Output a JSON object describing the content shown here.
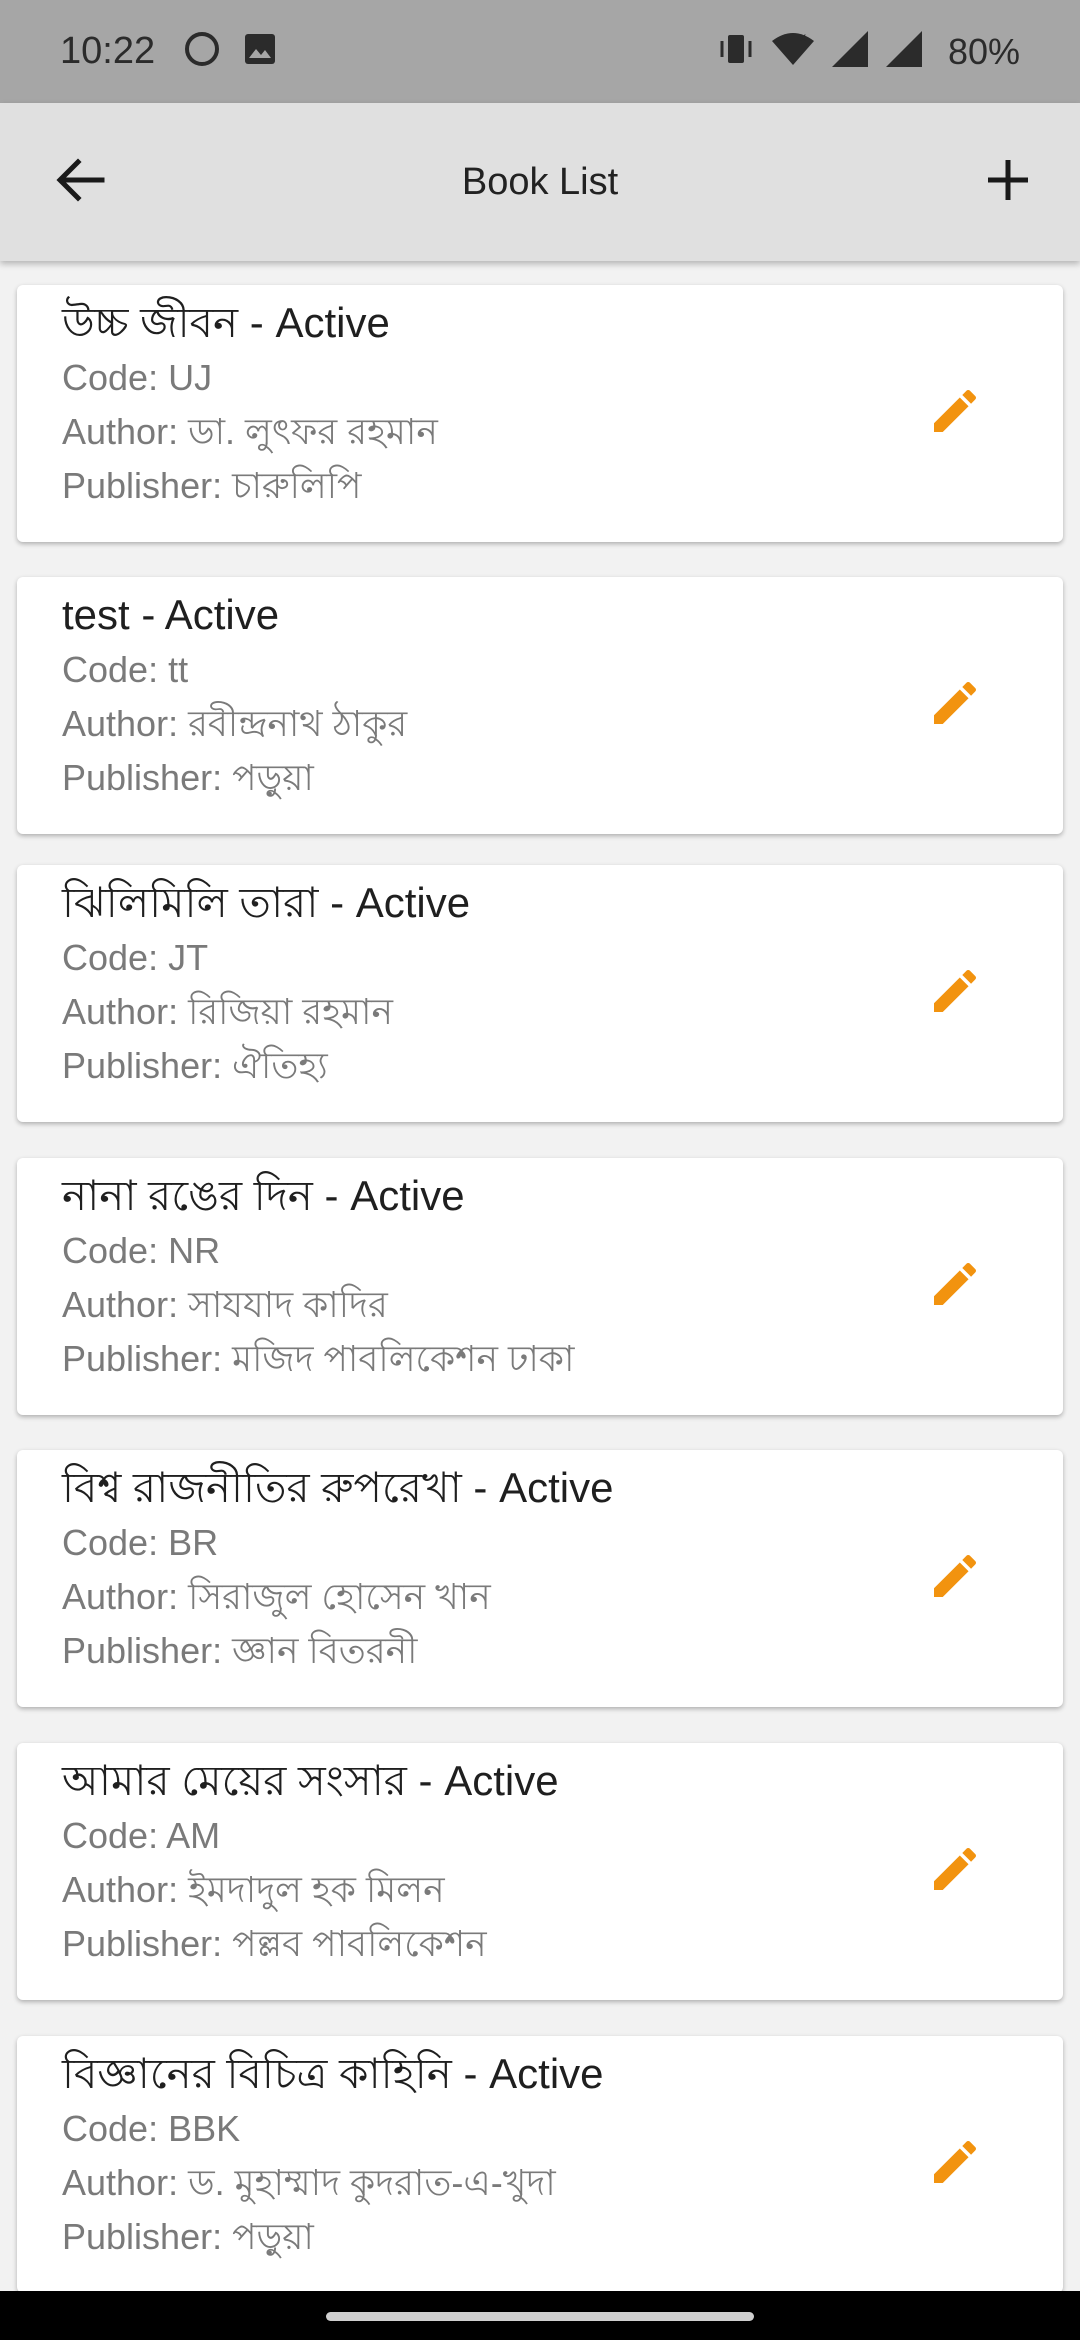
{
  "status_bar": {
    "time": "10:22",
    "battery": "80%",
    "icons": [
      "circle-icon",
      "image-icon",
      "vibrate-icon",
      "wifi-icon",
      "cell-signal-icon",
      "cell-signal-icon"
    ]
  },
  "app_bar": {
    "title": "Book List",
    "back_icon": "arrow-back-icon",
    "add_icon": "plus-icon"
  },
  "colors": {
    "accent_edit": "#f2930f",
    "status_bar_bg": "#a6a6a6",
    "app_bar_bg": "#e0e0e0"
  },
  "books": [
    {
      "title": "উচ্চ জীবন - Active",
      "code": "Code: UJ",
      "author": "Author: ডা. লুৎফর রহমান",
      "publisher": "Publisher: চারুলিপি"
    },
    {
      "title": "test - Active",
      "code": "Code: tt",
      "author": "Author: রবীন্দ্রনাথ ঠাকুর",
      "publisher": "Publisher: পড়ুয়া"
    },
    {
      "title": "ঝিলিমিলি তারা - Active",
      "code": "Code: JT",
      "author": "Author: রিজিয়া রহমান",
      "publisher": "Publisher: ঐতিহ্য"
    },
    {
      "title": "নানা রঙের দিন - Active",
      "code": "Code: NR",
      "author": "Author: সাযযাদ কাদির",
      "publisher": "Publisher: মজিদ পাবলিকেশন ঢাকা"
    },
    {
      "title": "বিশ্ব রাজনীতির রুপরেখা - Active",
      "code": "Code: BR",
      "author": "Author: সিরাজুল হোসেন খান",
      "publisher": "Publisher: জ্ঞান বিতরনী"
    },
    {
      "title": "আমার মেয়ের সংসার - Active",
      "code": "Code: AM",
      "author": "Author: ইমদাদুল হক মিলন",
      "publisher": "Publisher: পল্লব পাবলিকেশন"
    },
    {
      "title": "বিজ্ঞানের বিচিত্র কাহিনি - Active",
      "code": "Code: BBK",
      "author": "Author: ড. মুহাম্মাদ কুদরাত-এ-খুদা",
      "publisher": "Publisher: পড়ুয়া"
    }
  ]
}
